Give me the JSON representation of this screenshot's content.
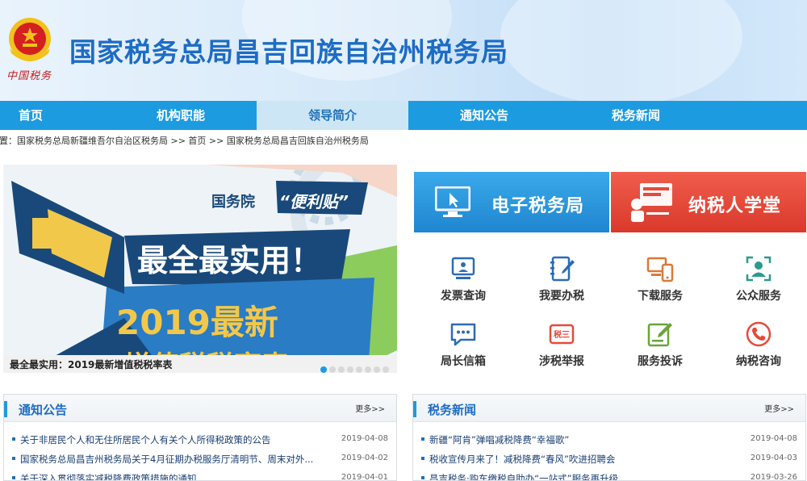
{
  "header": {
    "title": "国家税务总局昌吉回族自治州税务局",
    "emblem_text": "中国税务",
    "colors": {
      "title": "#1d6cc4",
      "emblem_text": "#c61c1c"
    }
  },
  "nav": {
    "items": [
      {
        "label": "首页",
        "active": false
      },
      {
        "label": "机构职能",
        "active": false
      },
      {
        "label": "领导简介",
        "active": true
      },
      {
        "label": "通知公告",
        "active": false
      },
      {
        "label": "税务新闻",
        "active": false
      }
    ],
    "colors": {
      "bar": "#1d9be0",
      "active": "#cde6f6"
    }
  },
  "breadcrumb": "位置：国家税务总局新疆维吾尔自治区税务局 >> 首页 >> 国家税务总局昌吉回族自治州税务局",
  "banner": {
    "line1_pre": "国务院",
    "line1_tag": "“便利贴”",
    "line2": "最全最实用！",
    "line3": "2019最新",
    "line4": "增值税税率表",
    "caption": "最全最实用：2019最新增值税税率表",
    "slide_count": 8,
    "active_slide": 0
  },
  "big_buttons": [
    {
      "label": "电子税务局",
      "icon": "monitor-cursor-icon",
      "color": "#2a96dd"
    },
    {
      "label": "纳税人学堂",
      "icon": "classroom-screen-icon",
      "color": "#e54a3a"
    }
  ],
  "services": [
    {
      "label": "发票查询",
      "icon": "invoice-monitor-icon"
    },
    {
      "label": "我要办税",
      "icon": "notebook-pen-icon"
    },
    {
      "label": "下载服务",
      "icon": "download-devices-icon"
    },
    {
      "label": "公众服务",
      "icon": "public-user-icon"
    },
    {
      "label": "局长信箱",
      "icon": "chat-bubble-icon"
    },
    {
      "label": "涉税举报",
      "icon": "tax-report-icon"
    },
    {
      "label": "服务投诉",
      "icon": "edit-complaint-icon"
    },
    {
      "label": "纳税咨询",
      "icon": "phone-consult-icon"
    }
  ],
  "notice_panel": {
    "title": "通知公告",
    "more": "更多>>",
    "items": [
      {
        "title": "关于非居民个人和无住所居民个人有关个人所得税政策的公告",
        "date": "2019-04-08"
      },
      {
        "title": "国家税务总局昌吉州税务局关于4月征期办税服务厅清明节、周末对外...",
        "date": "2019-04-02"
      },
      {
        "title": "关于深入贯彻落实减税降费政策措施的通知",
        "date": "2019-04-01"
      }
    ]
  },
  "news_panel": {
    "title": "税务新闻",
    "more": "更多>>",
    "items": [
      {
        "title": "新疆“阿肯”弹唱减税降费“幸福歌”",
        "date": "2019-04-08"
      },
      {
        "title": "税收宣传月来了！减税降费“春风”吹进招聘会",
        "date": "2019-04-03"
      },
      {
        "title": "昌吉税务·购车缴税自助办“一站式”服务再升级",
        "date": "2019-03-26"
      }
    ]
  }
}
